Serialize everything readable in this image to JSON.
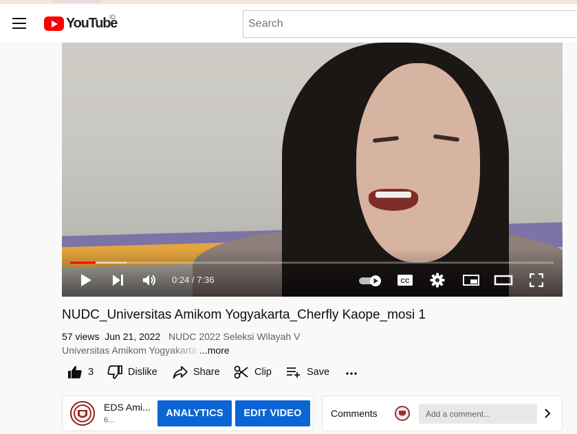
{
  "masthead": {
    "logo_text": "YouTube",
    "country_code": "ID",
    "search_placeholder": "Search"
  },
  "player": {
    "current_time": "0:24",
    "duration": "7:36",
    "time_display": "0:24 / 7:36",
    "played_fraction": 0.053,
    "buffered_fraction": 0.117,
    "autoplay_on": true
  },
  "video": {
    "title": "NUDC_Universitas Amikom Yogyakarta_Cherfly Kaope_mosi 1",
    "views": "57 views",
    "date": "Jun 21, 2022",
    "tag": "NUDC 2022 Seleksi Wilayah V",
    "description_preview": "Universitas Amikom Yogyakarta",
    "more_label": "...more"
  },
  "actions": {
    "like_count": "3",
    "dislike_label": "Dislike",
    "share_label": "Share",
    "clip_label": "Clip",
    "save_label": "Save"
  },
  "channel": {
    "name": "EDS Ami...",
    "subscribers": "6...",
    "analytics_label": "ANALYTICS",
    "edit_video_label": "EDIT VIDEO"
  },
  "comments": {
    "label": "Comments",
    "placeholder": "Add a comment..."
  },
  "colors": {
    "brand_red": "#ff0000",
    "button_blue": "#0b65d4"
  }
}
